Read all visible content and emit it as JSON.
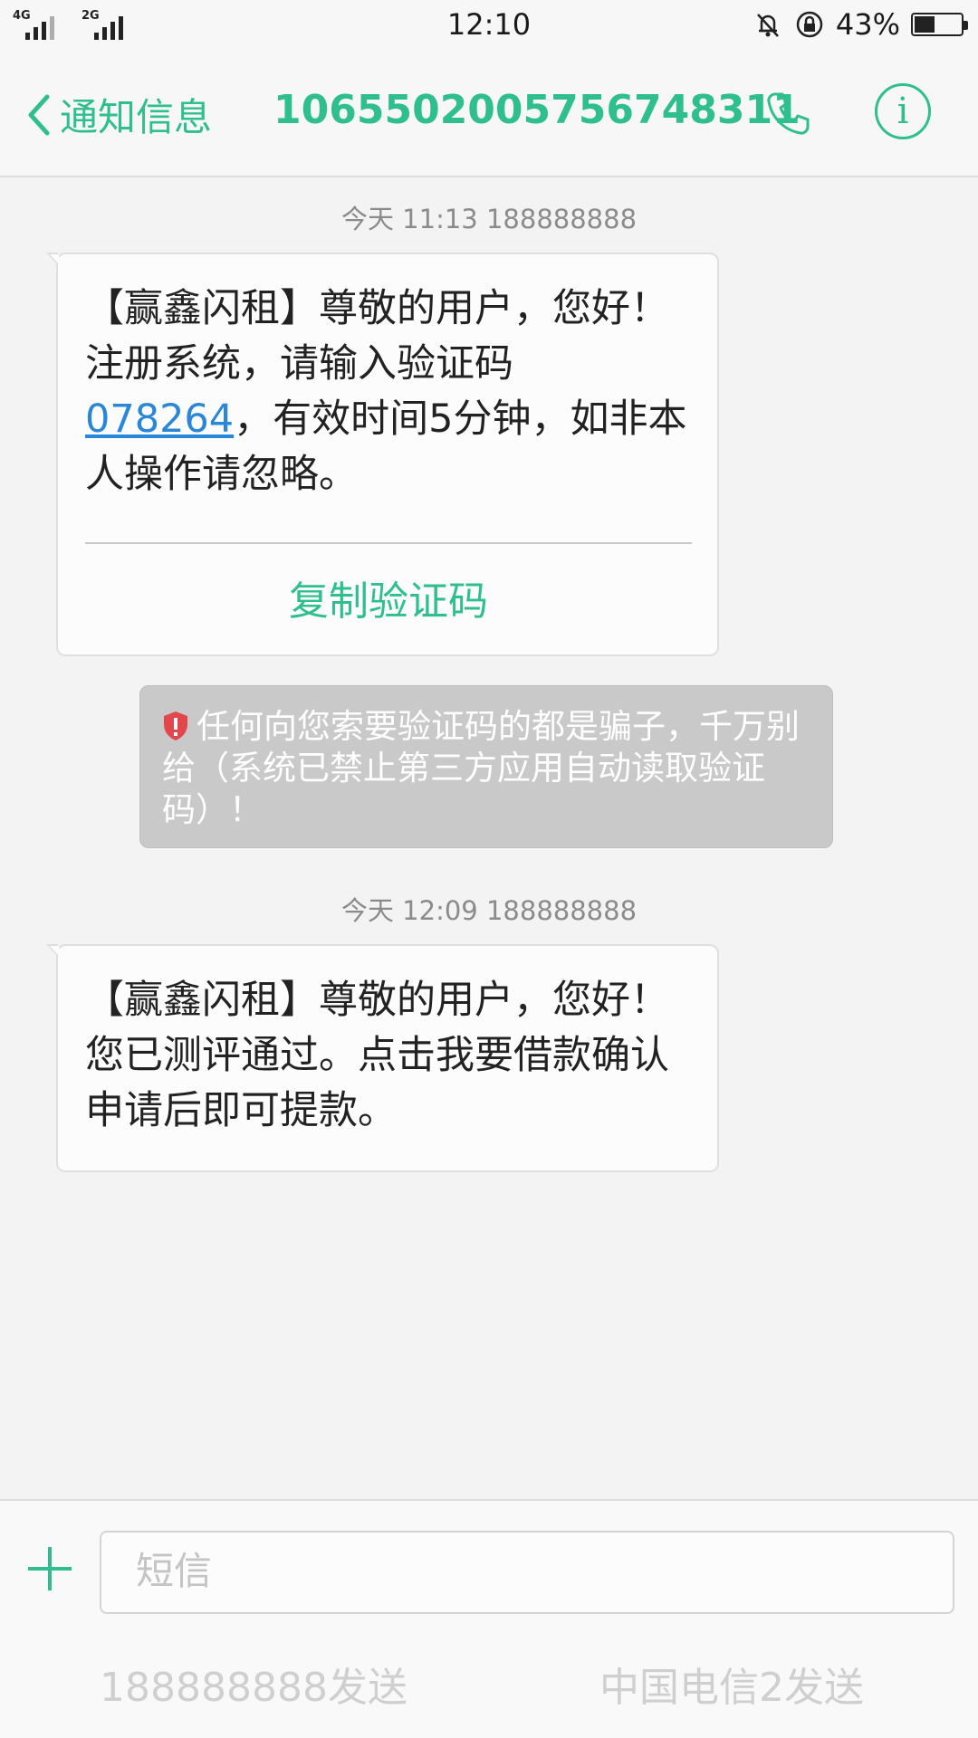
{
  "status_bar": {
    "sim1_tag": "4G",
    "sim2_tag": "2G",
    "time": "12:10",
    "battery_percent": "43%",
    "battery_level": 0.43
  },
  "header": {
    "back_label": "通知信息",
    "title": "1065502005756748311",
    "accent": "#2fbf8f"
  },
  "messages": [
    {
      "timestamp": "今天 11:13  188888888",
      "text_pre": "【赢鑫闪租】尊敬的用户，您好！注册系统，请输入验证码",
      "code": "078264",
      "text_post": "，有效时间5分钟，如非本人操作请忽略。",
      "action": "复制验证码"
    },
    {
      "timestamp": "今天 12:09  188888888",
      "text": "【赢鑫闪租】尊敬的用户，您好！您已测评通过。点击我要借款确认申请后即可提款。"
    }
  ],
  "warning": {
    "text": "任何向您索要验证码的都是骗子，千万别给（系统已禁止第三方应用自动读取验证码）！"
  },
  "composer": {
    "placeholder": "短信",
    "send_sim1": "188888888发送",
    "send_sim2": "中国电信2发送"
  }
}
